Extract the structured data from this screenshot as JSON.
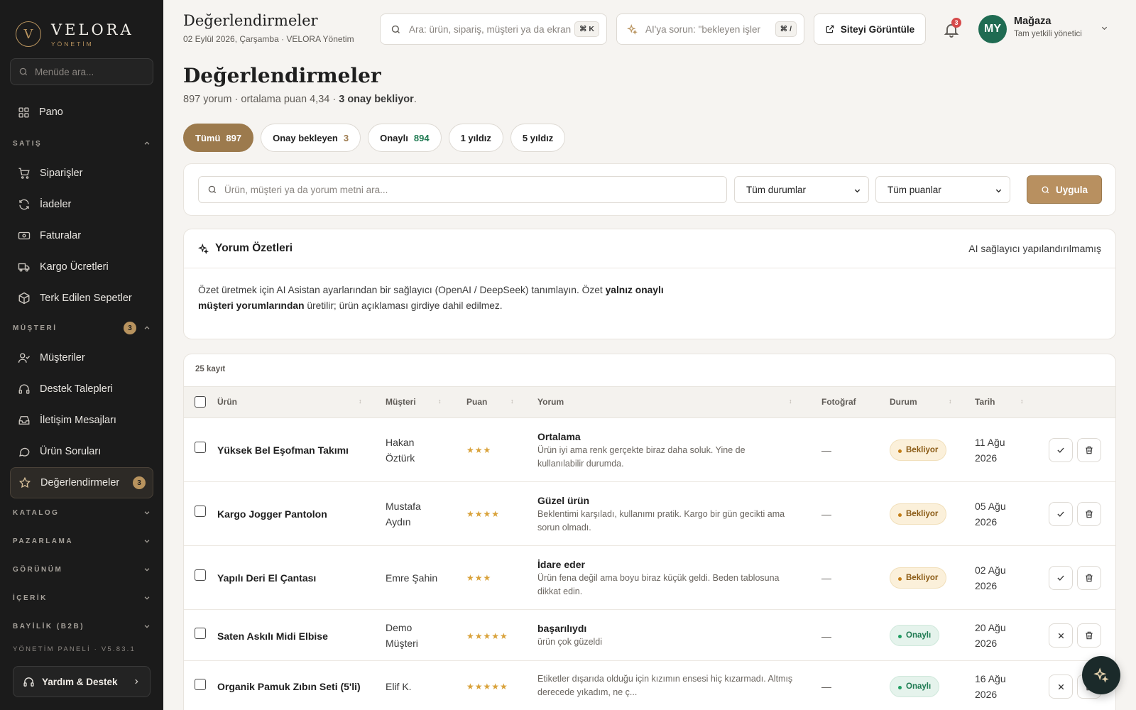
{
  "brand": {
    "name": "VELORA",
    "sub": "YÖNETİM",
    "mark": "V"
  },
  "sidebar": {
    "search_placeholder": "Menüde ara...",
    "dashboard": "Pano",
    "sales": {
      "title": "SATIŞ",
      "items": [
        "Siparişler",
        "İadeler",
        "Faturalar",
        "Kargo Ücretleri",
        "Terk Edilen Sepetler"
      ]
    },
    "customers": {
      "title": "MÜŞTERİ",
      "badge": "3",
      "items": [
        "Müşteriler",
        "Destek Talepleri",
        "İletişim Mesajları",
        "Ürün Soruları",
        "Değerlendirmeler"
      ],
      "active_badge": "3"
    },
    "sections": [
      "KATALOG",
      "PAZARLAMA",
      "GÖRÜNÜM",
      "İÇERİK",
      "BAYİLİK (B2B)"
    ],
    "version": "YÖNETİM PANELİ · V5.83.1",
    "help": "Yardım & Destek"
  },
  "topbar": {
    "title": "Değerlendirmeler",
    "subtitle": "02 Eylül 2026, Çarşamba · VELORA Yönetim",
    "search_placeholder": "Ara: ürün, sipariş, müşteri ya da ekran",
    "search_kbd": "⌘ K",
    "ai_placeholder": "AI'ya sorun: \"bekleyen işler",
    "ai_kbd": "⌘ /",
    "site_button": "Siteyi Görüntüle",
    "notif_count": "3",
    "user_initials": "MY",
    "user_name": "Mağaza",
    "user_role": "Tam yetkili yönetici"
  },
  "page": {
    "title": "Değerlendirmeler",
    "summary_prefix": "897 yorum · ortalama puan 4,34 · ",
    "summary_bold": "3 onay bekliyor",
    "summary_suffix": "."
  },
  "tabs": [
    {
      "label": "Tümü",
      "count": "897"
    },
    {
      "label": "Onay bekleyen",
      "count": "3"
    },
    {
      "label": "Onaylı",
      "count": "894"
    },
    {
      "label": "1 yıldız",
      "count": ""
    },
    {
      "label": "5 yıldız",
      "count": ""
    }
  ],
  "filters": {
    "search_placeholder": "Ürün, müşteri ya da yorum metni ara...",
    "status": "Tüm durumlar",
    "rating": "Tüm puanlar",
    "apply": "Uygula"
  },
  "summary_card": {
    "title": "Yorum Özetleri",
    "status": "AI sağlayıcı yapılandırılmamış",
    "text_1": "Özet üretmek için AI Asistan ayarlarından bir sağlayıcı (OpenAI / DeepSeek) tanımlayın. Özet ",
    "text_bold": "yalnız onaylı müşteri yorumlarından",
    "text_2": " üretilir; ürün açıklaması girdiye dahil edilmez."
  },
  "table": {
    "record_count": "25 kayıt",
    "headers": {
      "product": "Ürün",
      "customer": "Müşteri",
      "rating": "Puan",
      "review": "Yorum",
      "photo": "Fotoğraf",
      "status": "Durum",
      "date": "Tarih"
    },
    "rows": [
      {
        "product": "Yüksek Bel Eşofman Takımı",
        "customer_1": "Hakan",
        "customer_2": "Öztürk",
        "stars": "★★★",
        "rating": 3,
        "title": "Ortalama",
        "text": "Ürün iyi ama renk gerçekte biraz daha soluk. Yine de kullanılabilir durumda.",
        "photo": "—",
        "status": "Bekliyor",
        "date_1": "11 Ağu",
        "date_2": "2026"
      },
      {
        "product": "Kargo Jogger Pantolon",
        "customer_1": "Mustafa",
        "customer_2": "Aydın",
        "stars": "★★★★",
        "rating": 4,
        "title": "Güzel ürün",
        "text": "Beklentimi karşıladı, kullanımı pratik. Kargo bir gün gecikti ama sorun olmadı.",
        "photo": "—",
        "status": "Bekliyor",
        "date_1": "05 Ağu",
        "date_2": "2026"
      },
      {
        "product": "Yapılı Deri El Çantası",
        "customer_1": "Emre Şahin",
        "customer_2": "",
        "stars": "★★★",
        "rating": 3,
        "title": "İdare eder",
        "text": "Ürün fena değil ama boyu biraz küçük geldi. Beden tablosuna dikkat edin.",
        "photo": "—",
        "status": "Bekliyor",
        "date_1": "02 Ağu",
        "date_2": "2026"
      },
      {
        "product": "Saten Askılı Midi Elbise",
        "customer_1": "Demo",
        "customer_2": "Müşteri",
        "stars": "★★★★★",
        "rating": 5,
        "title": "başarılıydı",
        "text": "ürün çok güzeldi",
        "photo": "—",
        "status": "Onaylı",
        "date_1": "20 Ağu",
        "date_2": "2026"
      },
      {
        "product": "Organik Pamuk Zıbın Seti (5'li)",
        "customer_1": "Elif K.",
        "customer_2": "",
        "stars": "★★★★★",
        "rating": 5,
        "title": "",
        "text": "Etiketler dışarıda olduğu için kızımın ensesi hiç kızarmadı. Altmış derecede yıkadım, ne ç...",
        "photo": "—",
        "status": "Onaylı",
        "date_1": "16 Ağu",
        "date_2": "2026"
      }
    ]
  },
  "colors": {
    "accent": "#9c7a4d",
    "sidebar_bg": "#1b1b1b",
    "pending": "#c47d14",
    "approved": "#1f7a52"
  }
}
